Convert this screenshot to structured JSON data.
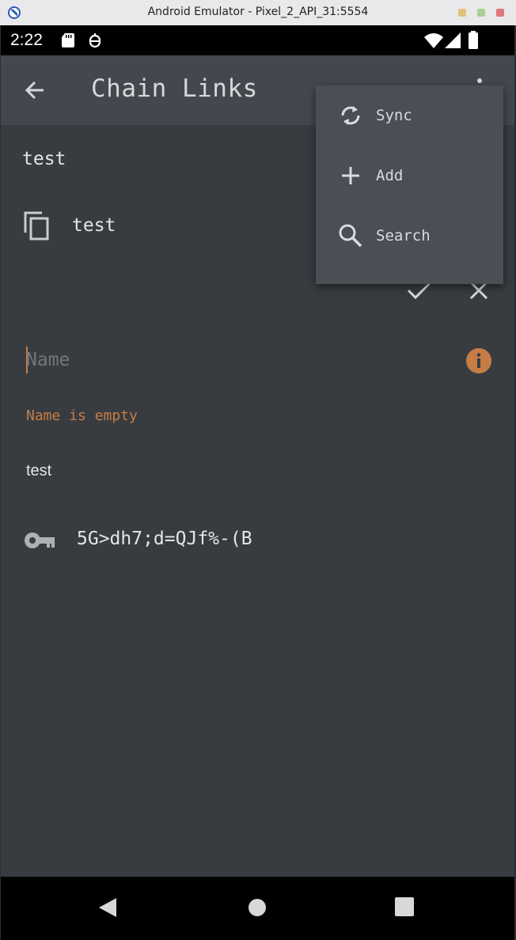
{
  "window": {
    "title": "Android Emulator - Pixel_2_API_31:5554",
    "controls": [
      "minimize",
      "maximize",
      "close"
    ],
    "control_colors": [
      "#e2c17d",
      "#a9cf96",
      "#e0787b"
    ]
  },
  "statusbar": {
    "time": "2:22",
    "left_icons": [
      "sd-card-icon",
      "debug-icon"
    ],
    "right_icons": [
      "wifi-icon",
      "signal-icon",
      "battery-icon"
    ]
  },
  "appbar": {
    "title": "Chain Links",
    "back_icon": "arrow-back-icon",
    "menu_icon": "overflow-menu-icon"
  },
  "content": {
    "header": "test",
    "copy_item_label": "test",
    "name_field": {
      "value": "",
      "placeholder": "Name"
    },
    "error_text": "Name is empty",
    "description": "test",
    "password": "5G>dh7;d=QJf%-(B"
  },
  "menu": {
    "items": [
      {
        "label": "Sync",
        "icon": "sync-icon"
      },
      {
        "label": "Add",
        "icon": "plus-icon"
      },
      {
        "label": "Search",
        "icon": "search-icon"
      }
    ]
  },
  "navbar": {
    "buttons": [
      "back-triangle-icon",
      "home-circle-icon",
      "recents-square-icon"
    ]
  },
  "colors": {
    "background": "#383c41",
    "appbar": "#44484e",
    "menu": "#4a4e55",
    "accent": "#c67c44",
    "text": "#e3e5e7"
  }
}
